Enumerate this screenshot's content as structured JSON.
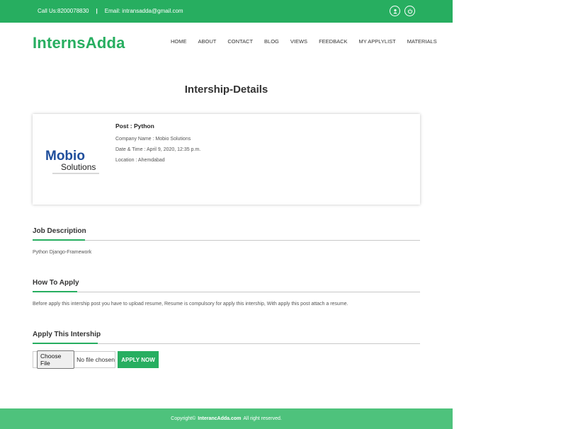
{
  "topbar": {
    "call": "Call Us:8200078830",
    "separator": "|",
    "email": "Email: intransadda@gmail.com",
    "icons": [
      "user-icon",
      "power-icon"
    ]
  },
  "brand": {
    "name": "InternsAdda",
    "color": "#27ae60"
  },
  "nav": {
    "items": [
      "HOME",
      "ABOUT",
      "CONTACT",
      "BLOG",
      "VIEWS",
      "FEEDBACK",
      "MY APPLYLIST",
      "MATERIALS"
    ]
  },
  "page": {
    "title": "Intership-Details"
  },
  "job_card": {
    "post": "Post : Python",
    "company": "Company Name : Mobio Solutions",
    "datetime": "Date & Time : April 9, 2020, 12:35 p.m.",
    "location": "Location : Ahemdabad",
    "logo_text": "Mobio",
    "logo_subtext": "Solutions"
  },
  "sections": {
    "job_description": {
      "title": "Job Description",
      "text": "Python Django-Framework"
    },
    "how_to_apply": {
      "title": "How To Apply",
      "text": "Before apply this intership post you have to upload resume, Resume is compulsory for apply this intership, With apply this post attach a resume."
    },
    "apply": {
      "title": "Apply This Intership",
      "file_button": "Choose File",
      "file_status": "No file chosen",
      "submit": "APPLY NOW"
    }
  },
  "footer": {
    "prefix": "Copyright©",
    "site": "InterancAdda.com",
    "suffix": "All right reserved."
  },
  "colors": {
    "accent": "#27ae60",
    "footer": "#4ec27c"
  }
}
